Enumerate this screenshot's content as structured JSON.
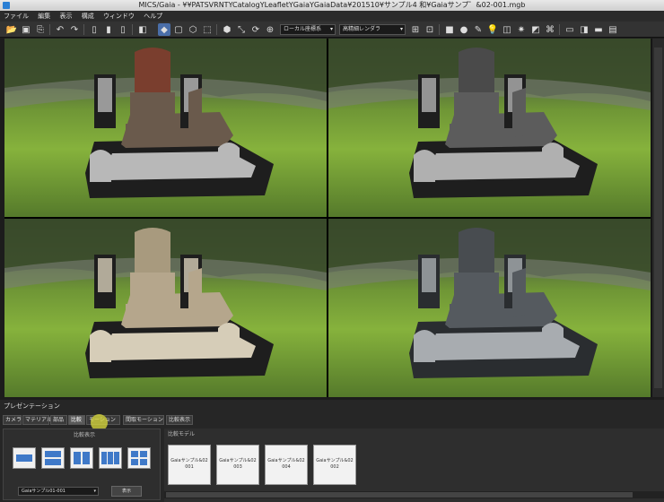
{
  "window": {
    "title": "MICS/Gaia - ¥¥PATSVRNTYCatalogYLeafletYGaiaYGaiaData¥201510¥サンプル4 和¥Gaiaサンプ゛&02-001.mgb"
  },
  "menu": {
    "items": [
      "ファイル",
      "編集",
      "表示",
      "構成",
      "ウィンドウ",
      "ヘルプ"
    ]
  },
  "toolbar": {
    "coordinate_select": "ローカル座標系",
    "render_select": "高精細レンダラ"
  },
  "viewports": [
    {
      "name": "viewport-top-left",
      "material": "red-granite",
      "colors": {
        "stone": "#6a5a4c",
        "dark": "#1e1e1e",
        "accent": "#7a3e2e",
        "light": "#b8b8b8"
      }
    },
    {
      "name": "viewport-top-right",
      "material": "grey-granite",
      "colors": {
        "stone": "#5c5c5c",
        "dark": "#1e1e1e",
        "accent": "#4a4a4a",
        "light": "#b0b0b0"
      }
    },
    {
      "name": "viewport-bottom-left",
      "material": "beige-granite",
      "colors": {
        "stone": "#b5a68c",
        "dark": "#1e1e1e",
        "accent": "#a89a7e",
        "light": "#d6cdb8"
      }
    },
    {
      "name": "viewport-bottom-right",
      "material": "dark-grey-granite",
      "colors": {
        "stone": "#555a5f",
        "dark": "#2a2d30",
        "accent": "#484c50",
        "light": "#a8acb0"
      }
    }
  ],
  "presentation": {
    "title": "プレゼンテーション",
    "tabs": [
      "カメラ",
      "マテリアル",
      "部品",
      "比較",
      "モーション",
      "間取モーション",
      "比較表示"
    ],
    "active_tab": "比較",
    "layout_panel_label": "比較表示",
    "layout_select": "Gaiaサンプル01-001",
    "apply_button": "表示",
    "model_panel_label": "比較モデル",
    "models": [
      "Gaiaサンプル&02\n001",
      "Gaiaサンプル&02\n003",
      "Gaiaサンプル&02\n004",
      "Gaiaサンプル&02\n002"
    ]
  },
  "colors": {
    "accent": "#3f79c8",
    "cursor": "#dcdc3c",
    "panel": "#262626"
  }
}
